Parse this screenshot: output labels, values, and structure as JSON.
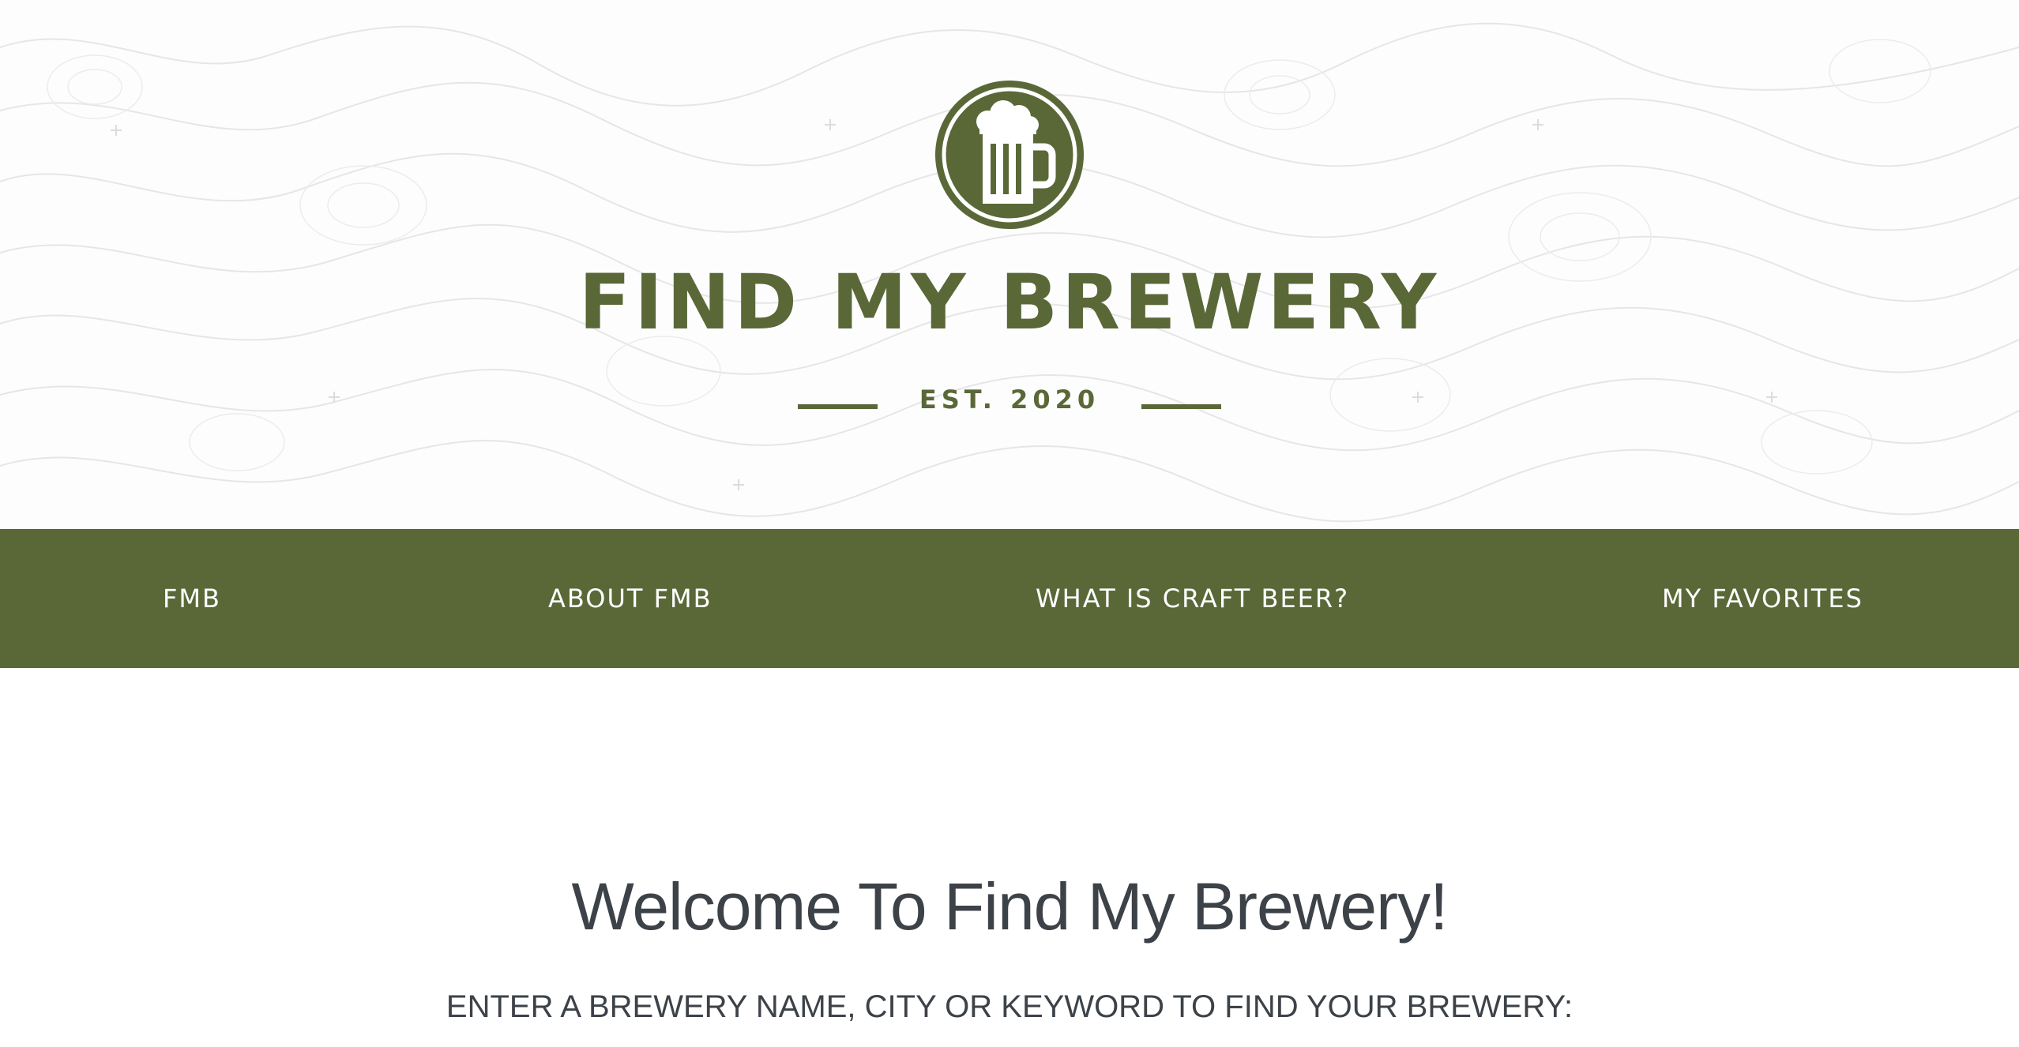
{
  "header": {
    "logo_icon": "beer-mug-icon",
    "title": "FIND MY BREWERY",
    "established": "EST. 2020",
    "background": "topographic-map-pattern"
  },
  "nav": {
    "items": [
      {
        "label": "FMB"
      },
      {
        "label": "ABOUT FMB"
      },
      {
        "label": "WHAT IS CRAFT BEER?"
      },
      {
        "label": "MY FAVORITES"
      }
    ]
  },
  "main": {
    "welcome_heading": "Welcome To Find My Brewery!",
    "search_prompt": "ENTER A BREWERY NAME, CITY OR KEYWORD TO FIND YOUR BREWERY:"
  },
  "colors": {
    "brand_green": "#5a6838",
    "text_dark": "#3c4248",
    "background": "#ffffff",
    "topo_lines": "#e4e4e4"
  }
}
